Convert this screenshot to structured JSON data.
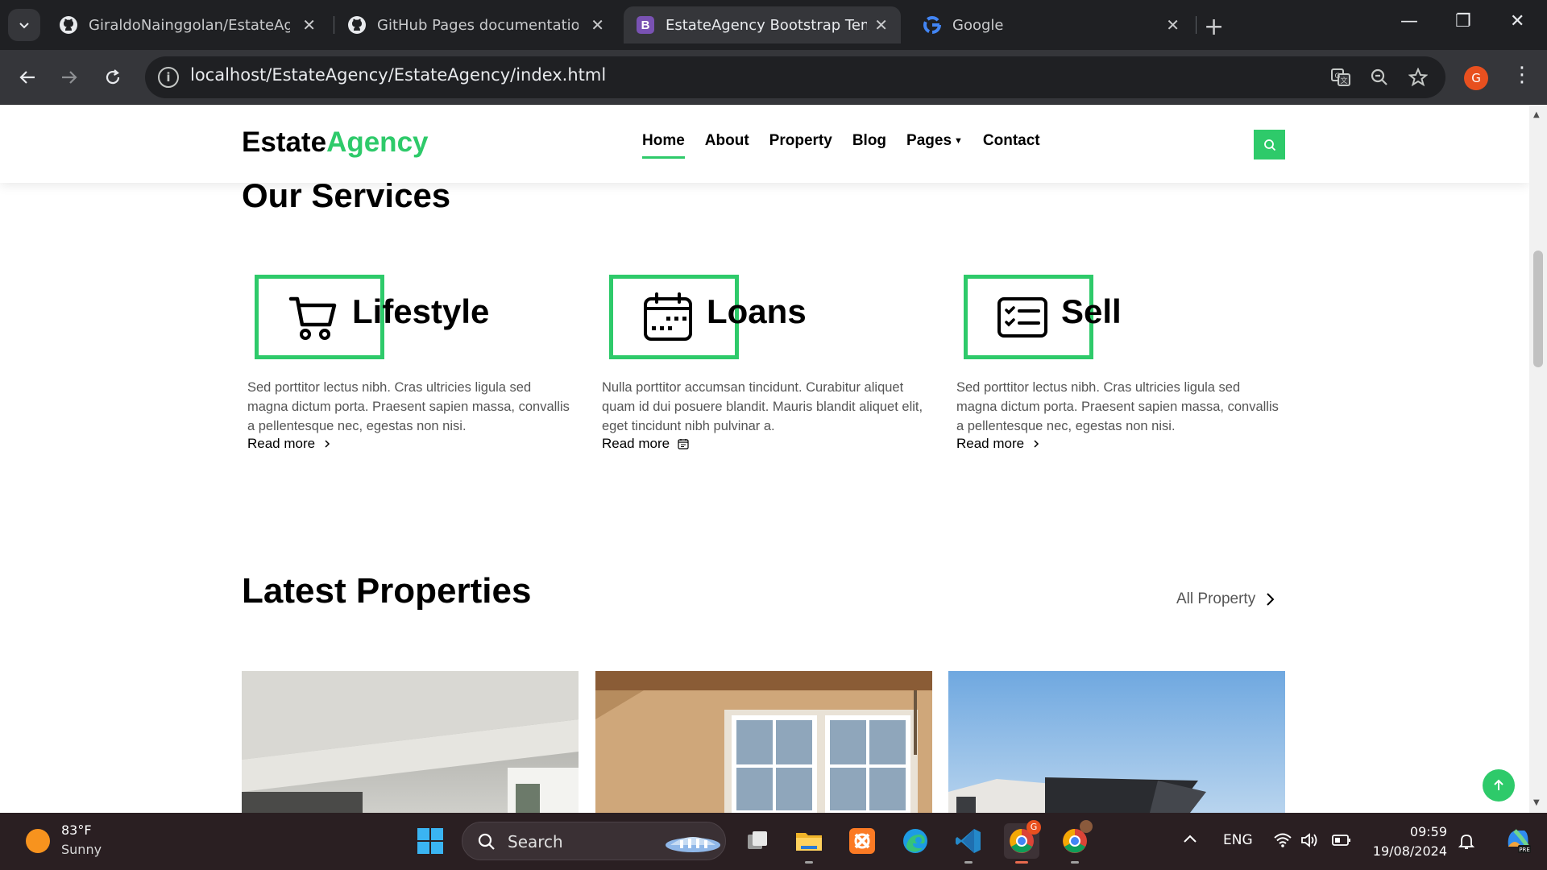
{
  "browser": {
    "tabs": [
      {
        "title": "GiraldoNainggolan/EstateAgency",
        "favicon": "github-icon",
        "active": false
      },
      {
        "title": "GitHub Pages documentation - GitHub Docs",
        "favicon": "github-icon",
        "active": false
      },
      {
        "title": "EstateAgency Bootstrap Template",
        "favicon": "bootstrap-icon",
        "active": true
      },
      {
        "title": "Google",
        "favicon": "google-icon",
        "active": false
      }
    ],
    "url": "localhost/EstateAgency/EstateAgency/index.html",
    "profile_initial": "G"
  },
  "site": {
    "brand_main": "Estate",
    "brand_accent": "Agency",
    "accent_color": "#2eca6a",
    "nav": [
      "Home",
      "About",
      "Property",
      "Blog",
      "Pages",
      "Contact"
    ],
    "active_nav": "Home"
  },
  "services": {
    "heading": "Our Services",
    "items": [
      {
        "title": "Lifestyle",
        "icon": "cart-icon",
        "text": "Sed porttitor lectus nibh. Cras ultricies ligula sed magna dictum porta. Praesent sapien massa, convallis a pellentesque nec, egestas non nisi.",
        "link": "Read more",
        "link_icon": "chevron-right-icon"
      },
      {
        "title": "Loans",
        "icon": "calendar-icon",
        "text": "Nulla porttitor accumsan tincidunt. Curabitur aliquet quam id dui posuere blandit. Mauris blandit aliquet elit, eget tincidunt nibh pulvinar a.",
        "link": "Read more",
        "link_icon": "calendar-small-icon"
      },
      {
        "title": "Sell",
        "icon": "card-checklist-icon",
        "text": "Sed porttitor lectus nibh. Cras ultricies ligula sed magna dictum porta. Praesent sapien massa, convallis a pellentesque nec, egestas non nisi.",
        "link": "Read more",
        "link_icon": "chevron-right-icon"
      }
    ]
  },
  "properties": {
    "heading": "Latest Properties",
    "all_link": "All Property"
  },
  "taskbar": {
    "weather_temp": "83°F",
    "weather_condition": "Sunny",
    "search_label": "Search",
    "language": "ENG",
    "time": "09:59",
    "date": "19/08/2024"
  }
}
